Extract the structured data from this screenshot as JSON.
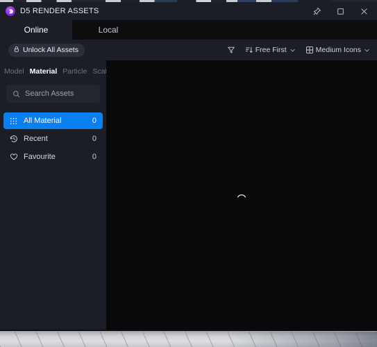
{
  "titlebar": {
    "logo_icon": "d5-logo-icon",
    "title": "D5 RENDER ASSETS",
    "controls": [
      {
        "name": "pin-icon",
        "label": "Pin"
      },
      {
        "name": "maximize-icon",
        "label": "Maximize"
      },
      {
        "name": "close-icon",
        "label": "Close"
      }
    ]
  },
  "tabs": [
    {
      "label": "Online",
      "active": true
    },
    {
      "label": "Local",
      "active": false
    }
  ],
  "toolbar": {
    "unlock_icon": "lock-icon",
    "unlock_label": "Unlock All Assets",
    "filter_icon": "filter-funnel-icon",
    "sort_icon": "sort-descending-icon",
    "sort_label": "Free First",
    "sort_chevron": "⌄",
    "view_icon": "grid-view-icon",
    "view_label": "Medium Icons",
    "view_chevron": "⌄"
  },
  "sidebar": {
    "category_tabs": [
      {
        "label": "Model",
        "active": false
      },
      {
        "label": "Material",
        "active": true
      },
      {
        "label": "Particle",
        "active": false
      },
      {
        "label": "Scatte",
        "active": false
      }
    ],
    "search": {
      "icon": "search-icon",
      "placeholder": "Search Assets",
      "value": ""
    },
    "nav_items": [
      {
        "icon": "grid-dots-icon",
        "label": "All Material",
        "count": "0",
        "selected": true
      },
      {
        "icon": "clock-history-icon",
        "label": "Recent",
        "count": "0",
        "selected": false
      },
      {
        "icon": "heart-icon",
        "label": "Favourite",
        "count": "0",
        "selected": false
      }
    ]
  },
  "content": {
    "state": "loading",
    "spinner_icon": "loading-spinner-icon"
  },
  "colors": {
    "accent_blue": "#0a7ff0",
    "panel_navy": "#1b1e27",
    "content_black": "#09090b",
    "tabstrip_black": "#0d0d0f",
    "logo_purple": "#8a2be6"
  }
}
